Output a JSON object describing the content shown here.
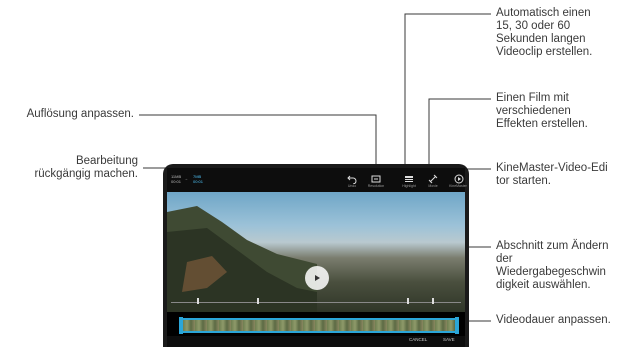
{
  "callouts": {
    "resolution": "Auflösung anpassen.",
    "undo_line1": "Bearbeitung",
    "undo_line2": "rückgängig machen.",
    "autoclip_line1": "Automatisch einen",
    "autoclip_line2": "15, 30 oder 60",
    "autoclip_line3": "Sekunden langen",
    "autoclip_line4": "Videoclip erstellen.",
    "film_line1": "Einen Film mit",
    "film_line2": "verschiedenen",
    "film_line3": "Effekten erstellen.",
    "kinemaster_line1": "KineMaster-Video-Edi",
    "kinemaster_line2": "tor starten.",
    "speed_line1": "Abschnitt zum Ändern",
    "speed_line2": "der",
    "speed_line3": "Wiedergabegeschwin",
    "speed_line4": "digkeit auswählen.",
    "duration": "Videodauer anpassen."
  },
  "screen": {
    "duration_value": "11MB",
    "duration_time": "00:01",
    "arrow": "→",
    "target_size": "7MB",
    "target_time": "00:01",
    "toolbar": [
      {
        "label": "Undo",
        "icon": "undo-icon"
      },
      {
        "label": "Resolution",
        "icon": "resolution-icon"
      },
      {
        "label": "Highlight",
        "icon": "highlight-icon"
      },
      {
        "label": "Movie",
        "icon": "movie-effects-icon"
      },
      {
        "label": "KineMaster",
        "icon": "kinemaster-icon"
      }
    ],
    "cancel_label": "CANCEL",
    "save_label": "SAVE"
  },
  "colors": {
    "accent": "#2ba6d8",
    "callout_line": "#3a3a3a"
  }
}
